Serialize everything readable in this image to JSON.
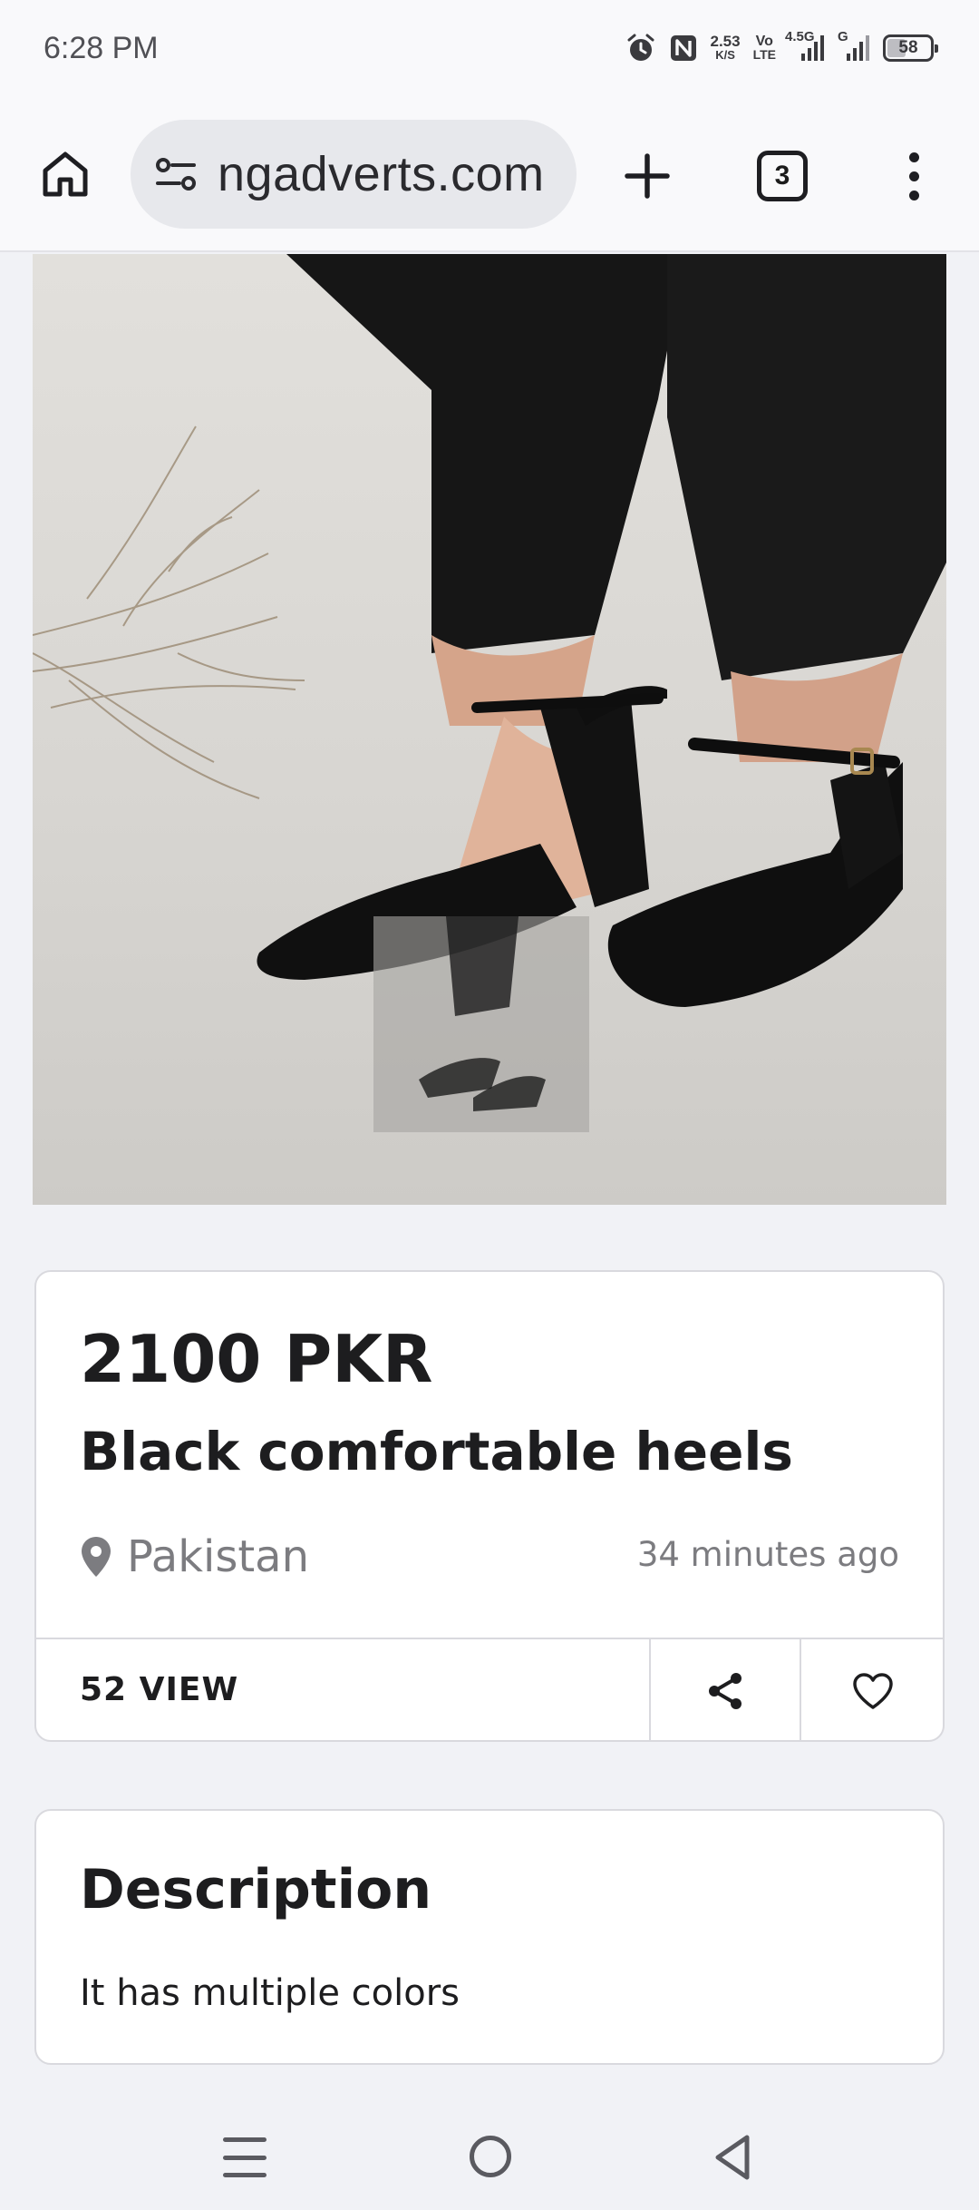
{
  "status_bar": {
    "time": "6:28 PM",
    "net_speed_value": "2.53",
    "net_speed_unit": "K/S",
    "volte_top": "Vo",
    "volte_bottom": "LTE",
    "net_type": "4.5G",
    "sim2_label": "G",
    "battery": "58",
    "icons": [
      "alarm-icon",
      "nfc-icon",
      "signal-icon",
      "battery-icon"
    ]
  },
  "browser": {
    "url": "ngadverts.com",
    "tab_count": "3",
    "icons": [
      "home-icon",
      "site-settings-icon",
      "plus-icon",
      "overflow-menu-icon"
    ]
  },
  "listing": {
    "price": "2100 PKR",
    "title": "Black comfortable heels",
    "location": "Pakistan",
    "posted": "34 minutes ago",
    "views": "52 VIEW"
  },
  "description": {
    "heading": "Description",
    "text": "It has multiple colors"
  },
  "colors": {
    "background": "#f1f2f6",
    "card": "#ffffff",
    "text": "#1d1d1f",
    "muted": "#7c7c80"
  }
}
